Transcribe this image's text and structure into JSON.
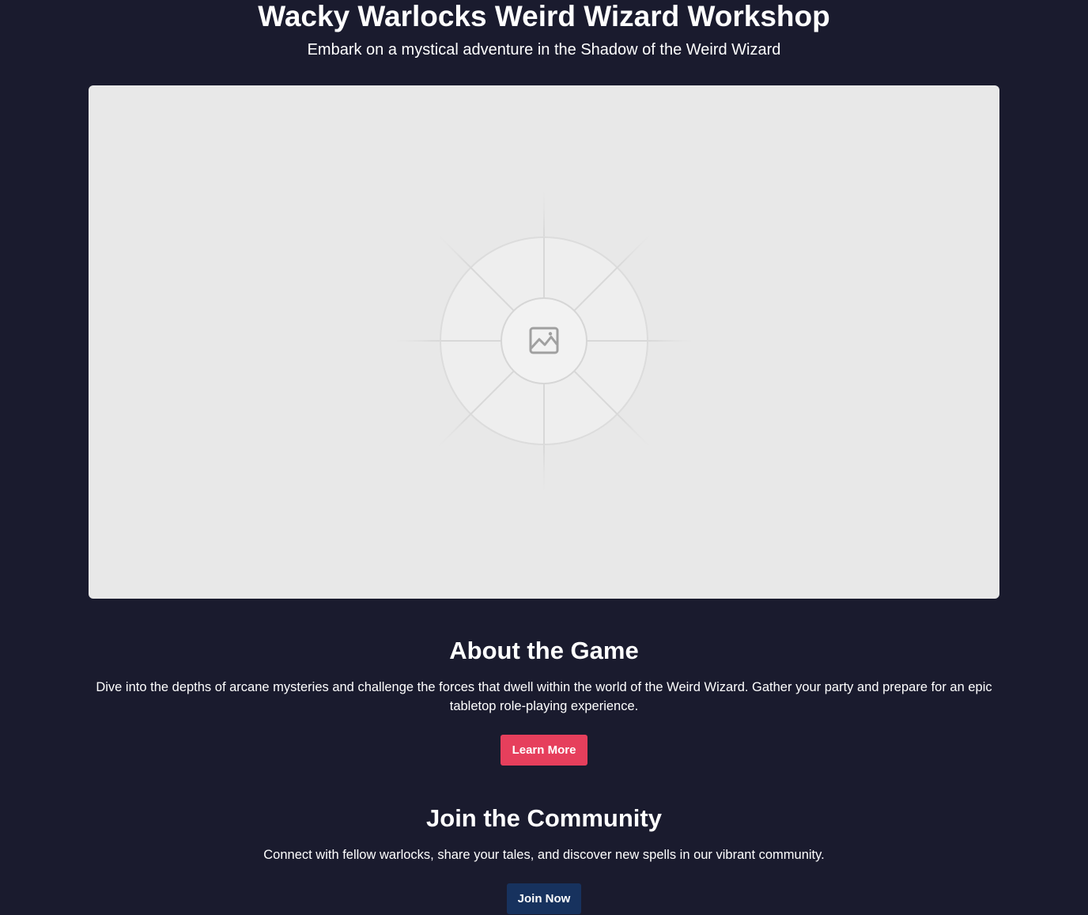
{
  "header": {
    "title": "Wacky Warlocks Weird Wizard Workshop",
    "subtitle": "Embark on a mystical adventure in the Shadow of the Weird Wizard"
  },
  "hero": {
    "placeholder_icon": "image-icon"
  },
  "about": {
    "title": "About the Game",
    "text": "Dive into the depths of arcane mysteries and challenge the forces that dwell within the world of the Weird Wizard. Gather your party and prepare for an epic tabletop role-playing experience.",
    "button_label": "Learn More"
  },
  "community": {
    "title": "Join the Community",
    "text": "Connect with fellow warlocks, share your tales, and discover new spells in our vibrant community.",
    "button_label": "Join Now"
  },
  "colors": {
    "background": "#1a1b2e",
    "hero_placeholder": "#e8e8e8",
    "learn_more_button": "#e63f5c",
    "join_now_button": "#17325e"
  }
}
